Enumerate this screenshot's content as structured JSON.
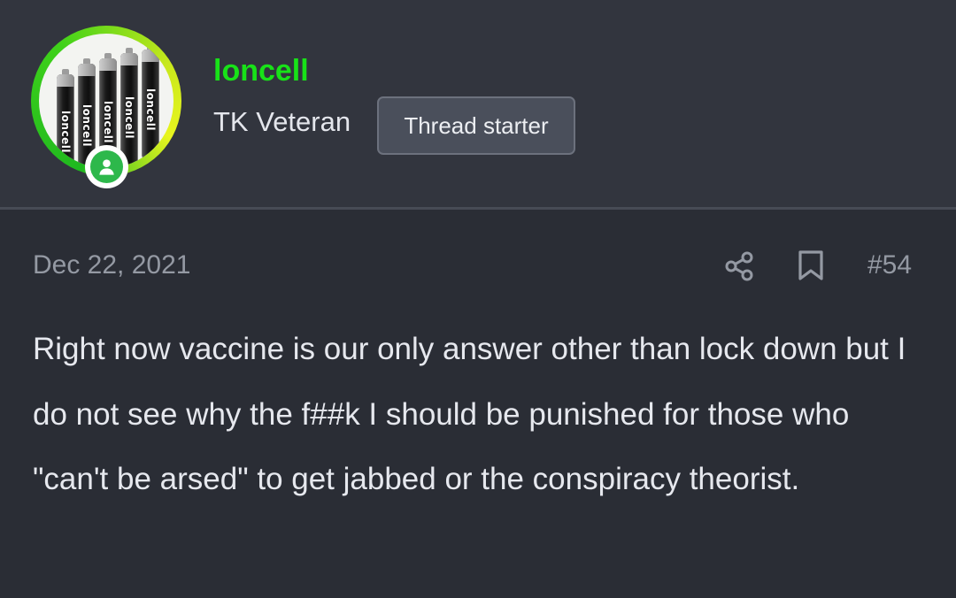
{
  "user": {
    "username": "loncell",
    "title": "TK Veteran",
    "badge": "Thread starter",
    "avatar_battery_brand": "loncell",
    "username_color": "#18e218",
    "online_status_icon": "user-online-icon"
  },
  "post": {
    "date": "Dec 22, 2021",
    "number": "#54",
    "actions": [
      {
        "icon": "share-icon"
      },
      {
        "icon": "bookmark-icon"
      }
    ],
    "body": "Right now vaccine is our only answer other than lock down but I do not see why the f##k I should be punished for those who \"can't be arsed\" to get jabbed or the conspiracy theorist."
  }
}
